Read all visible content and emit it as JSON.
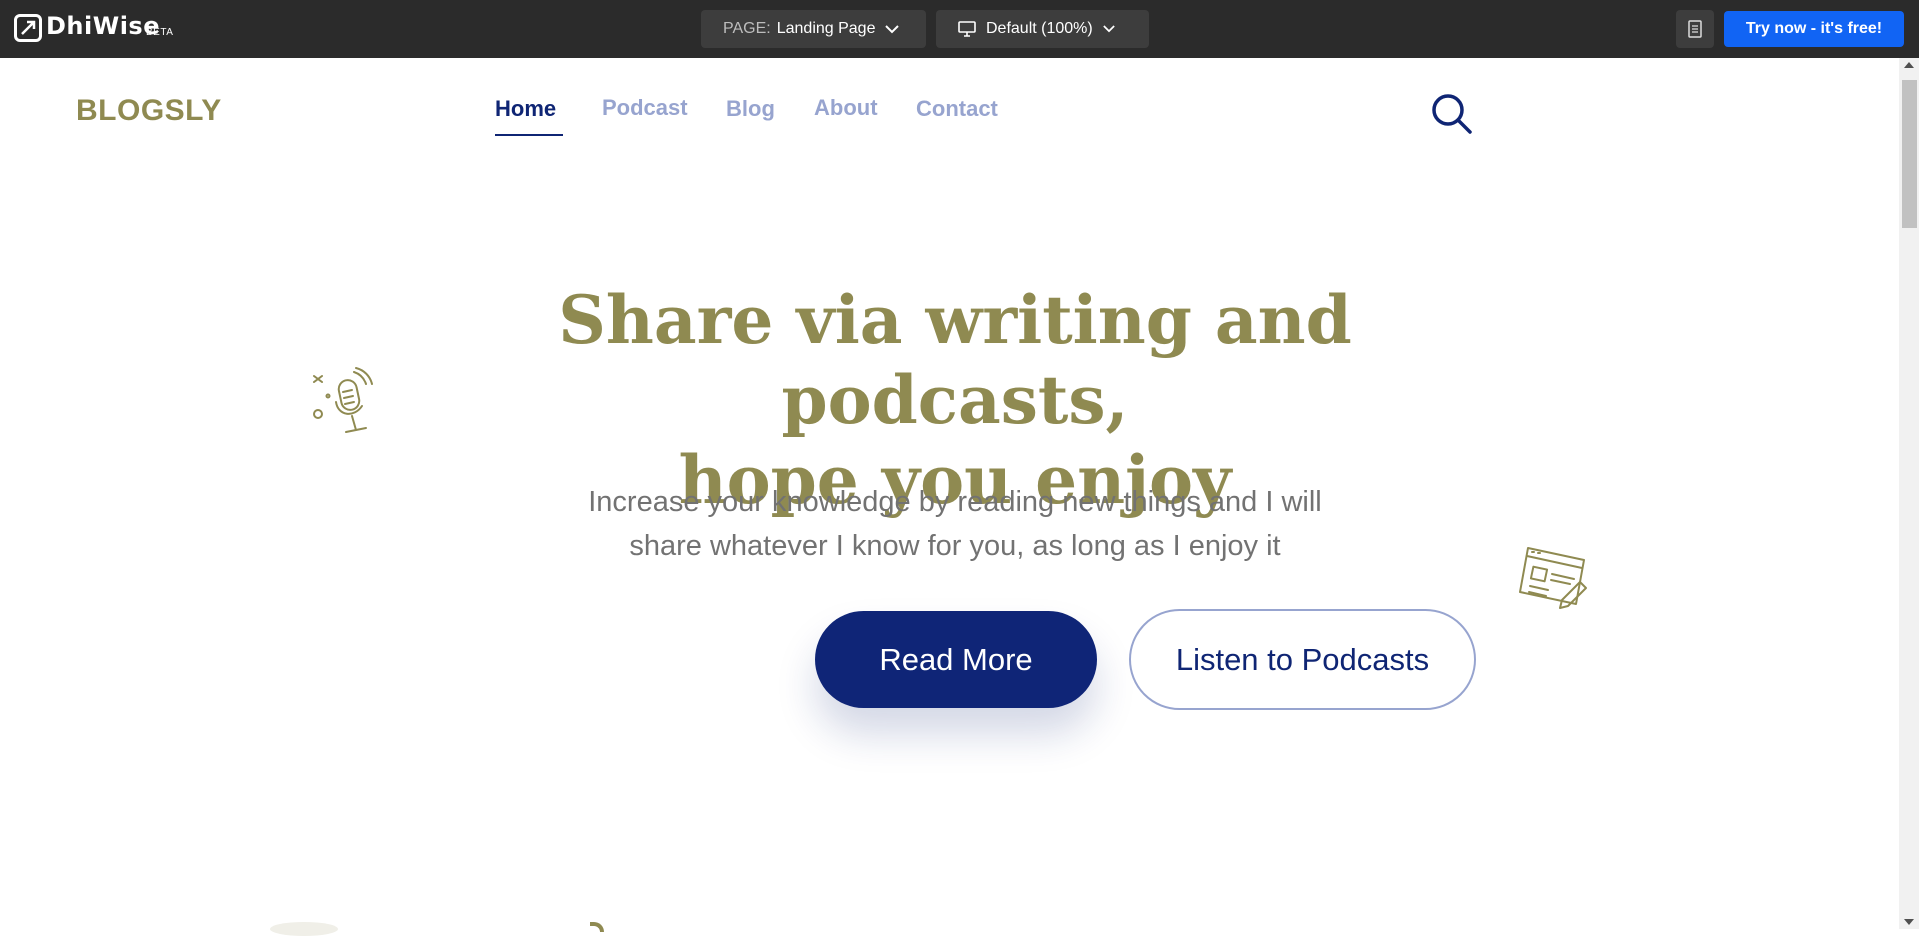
{
  "toolbar": {
    "brand": "DhiWise",
    "beta": "BETA",
    "page_prefix": "PAGE:",
    "page_value": "Landing Page",
    "viewport": "Default (100%)",
    "try_button": "Try now - it's free!"
  },
  "site": {
    "logo": "BLOGSLY",
    "nav": [
      {
        "label": "Home",
        "active": true
      },
      {
        "label": "Podcast",
        "active": false
      },
      {
        "label": "Blog",
        "active": false
      },
      {
        "label": "About",
        "active": false
      },
      {
        "label": "Contact",
        "active": false
      }
    ]
  },
  "hero": {
    "title_line1": "Share via writing and podcasts,",
    "title_line2": "hope you enjoy",
    "subtitle_line1": "Increase your knowledge by reading new things and I will",
    "subtitle_line2": "share whatever I know for you, as long as I enjoy it",
    "primary_button": "Read More",
    "secondary_button": "Listen to Podcasts"
  },
  "icons": {
    "logo": "dhiwise-logo-icon",
    "document": "document-icon",
    "monitor": "monitor-icon",
    "chevron": "chevron-down-icon",
    "search": "search-icon",
    "microphone": "microphone-icon",
    "newspaper": "newspaper-icon"
  },
  "colors": {
    "toolbar_bg": "#2b2b2b",
    "try_button": "#1164f4",
    "olive": "#8f8a51",
    "navy": "#0f2577",
    "nav_inactive": "#97a4cf",
    "subtitle": "#727272"
  }
}
